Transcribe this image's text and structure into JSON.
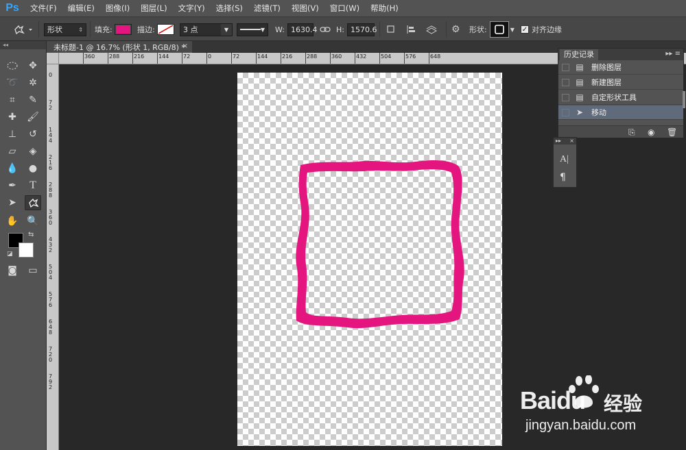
{
  "app": {
    "logo": "Ps"
  },
  "menu": [
    "文件(F)",
    "编辑(E)",
    "图像(I)",
    "图层(L)",
    "文字(Y)",
    "选择(S)",
    "滤镜(T)",
    "视图(V)",
    "窗口(W)",
    "帮助(H)"
  ],
  "options": {
    "mode_value": "形状",
    "fill_label": "填充:",
    "fill_color": "#e4157f",
    "stroke_label": "描边:",
    "stroke_width": "3 点",
    "w_label": "W:",
    "w_value": "1630.4",
    "h_label": "H:",
    "h_value": "1570.6",
    "shape_label": "形状:",
    "align_label": "对齐边缘",
    "align_checked": true
  },
  "document": {
    "tab_title": "未标题-1 @ 16.7% (形状 1, RGB/8) *",
    "close_glyph": "×",
    "shape_color": "#e4157f"
  },
  "rulers": {
    "h_labels": [
      "360",
      "288",
      "216",
      "144",
      "72",
      "0",
      "72",
      "144",
      "216",
      "288",
      "360",
      "432",
      "504",
      "576",
      "648"
    ],
    "v_labels": [
      "0",
      "7 2",
      "1 4 4",
      "2 1 6",
      "2 8 8",
      "3 6 0",
      "4 3 2",
      "5 0 4",
      "5 7 6",
      "6 4 8",
      "7 2 0",
      "7 9 2"
    ]
  },
  "history": {
    "title": "历史记录",
    "items": [
      {
        "label": "删除图层",
        "icon": "document-icon",
        "selected": false
      },
      {
        "label": "新建图层",
        "icon": "document-icon",
        "selected": false
      },
      {
        "label": "自定形状工具",
        "icon": "document-icon",
        "selected": false
      },
      {
        "label": "移动",
        "icon": "move-icon",
        "selected": true
      }
    ]
  },
  "watermark": {
    "brand": "Baidu",
    "cn": "经验",
    "url": "jingyan.baidu.com"
  }
}
